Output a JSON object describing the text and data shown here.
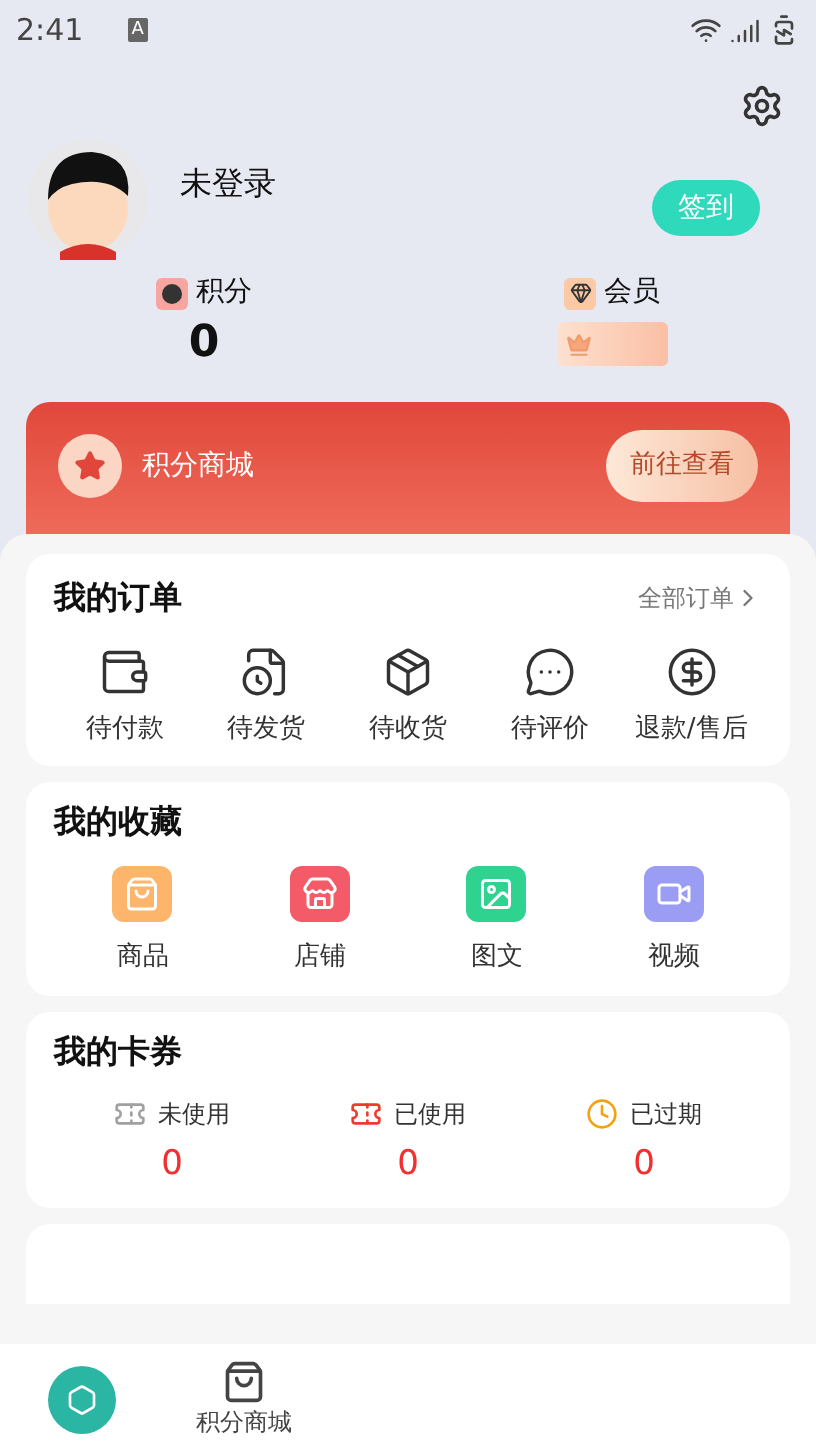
{
  "status_bar": {
    "time": "2:41",
    "badge": "A"
  },
  "profile": {
    "name": "未登录",
    "sign_in_button": "签到"
  },
  "stats": [
    {
      "label": "积分",
      "value": "0",
      "kind": "points"
    },
    {
      "label": "会员",
      "kind": "vip"
    }
  ],
  "banner": {
    "title": "积分商城",
    "button": "前往查看"
  },
  "orders": {
    "title": "我的订单",
    "link": "全部订单",
    "items": [
      {
        "label": "待付款",
        "kind": "wallet"
      },
      {
        "label": "待发货",
        "kind": "doc"
      },
      {
        "label": "待收货",
        "kind": "box"
      },
      {
        "label": "待评价",
        "kind": "chat"
      },
      {
        "label": "退款/售后",
        "kind": "refund"
      }
    ]
  },
  "favorites": {
    "title": "我的收藏",
    "items": [
      {
        "label": "商品",
        "kind": "bag"
      },
      {
        "label": "店铺",
        "kind": "shop"
      },
      {
        "label": "图文",
        "kind": "image"
      },
      {
        "label": "视频",
        "kind": "video"
      }
    ]
  },
  "coupons": {
    "title": "我的卡券",
    "items": [
      {
        "label": "未使用",
        "value": "0",
        "kind": "unused"
      },
      {
        "label": "已使用",
        "value": "0",
        "kind": "used"
      },
      {
        "label": "已过期",
        "value": "0",
        "kind": "expired"
      }
    ]
  },
  "bottom_nav": [
    {
      "label": "积分商城",
      "selected": false
    }
  ]
}
